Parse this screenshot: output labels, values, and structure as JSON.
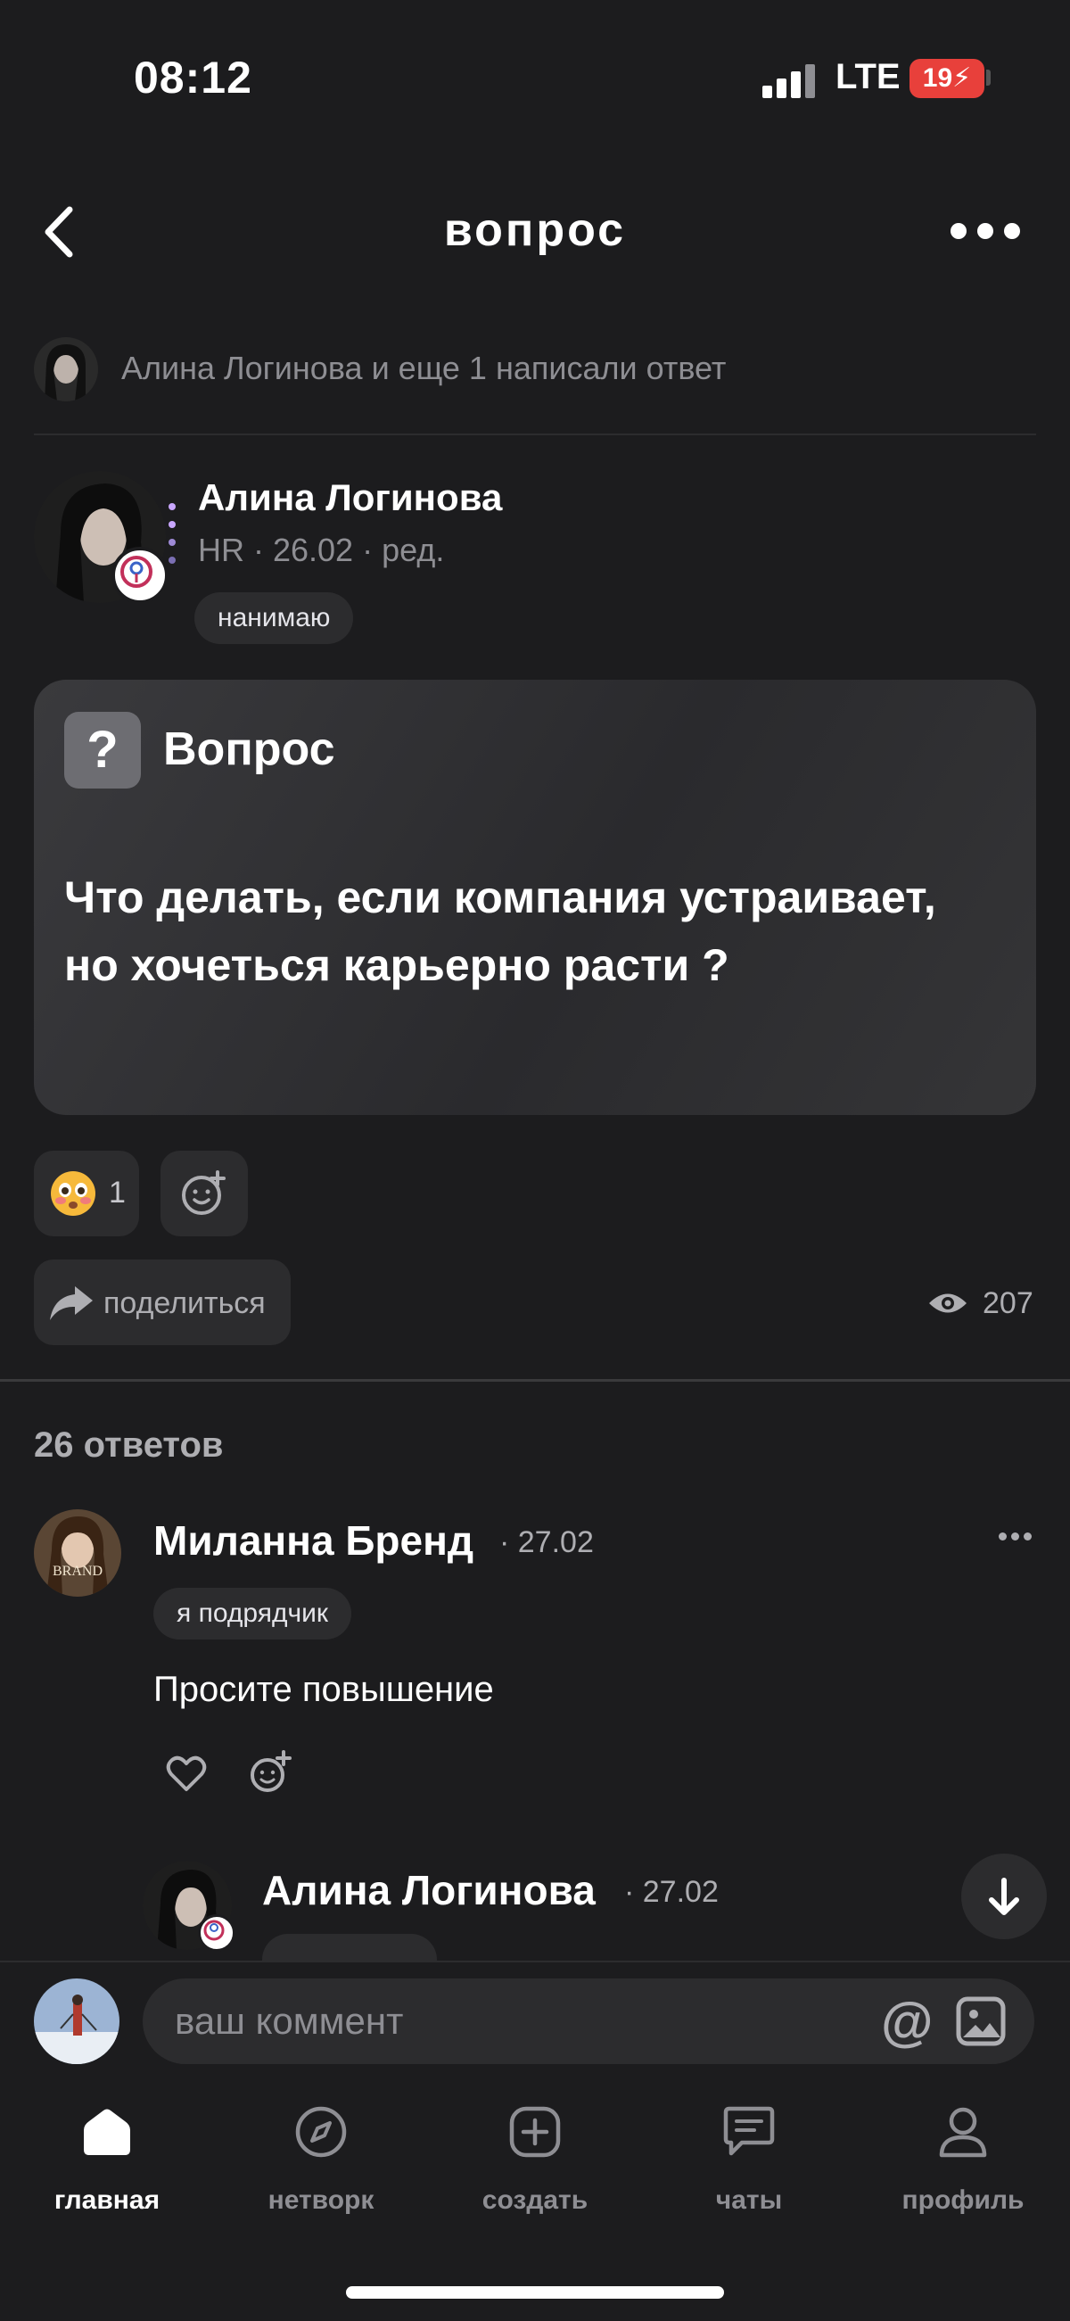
{
  "status": {
    "time": "08:12",
    "network": "LTE",
    "battery": "19"
  },
  "nav": {
    "title": "вопрос"
  },
  "answered_by": "Алина Логинова и еще 1 написали ответ",
  "author": {
    "name": "Алина Логинова",
    "meta": "HR · 26.02 · ред.",
    "tag": "нанимаю"
  },
  "question": {
    "label": "Вопрос",
    "icon": "?",
    "text": "Что делать, если компания устраивает, но хочеться карьерно расти ?"
  },
  "reactions": {
    "count": "1"
  },
  "share_label": "поделиться",
  "views": "207",
  "answers_title": "26 ответов",
  "comment": {
    "name": "Миланна Бренд",
    "date": "· 27.02",
    "tag": "я подрядчик",
    "text": "Просите повышение"
  },
  "reply": {
    "name": "Алина Логинова",
    "date": "· 27.02"
  },
  "input": {
    "placeholder": "ваш коммент",
    "at": "@"
  },
  "tabs": [
    {
      "label": "главная"
    },
    {
      "label": "нетворк"
    },
    {
      "label": "создать"
    },
    {
      "label": "чаты"
    },
    {
      "label": "профиль"
    }
  ]
}
